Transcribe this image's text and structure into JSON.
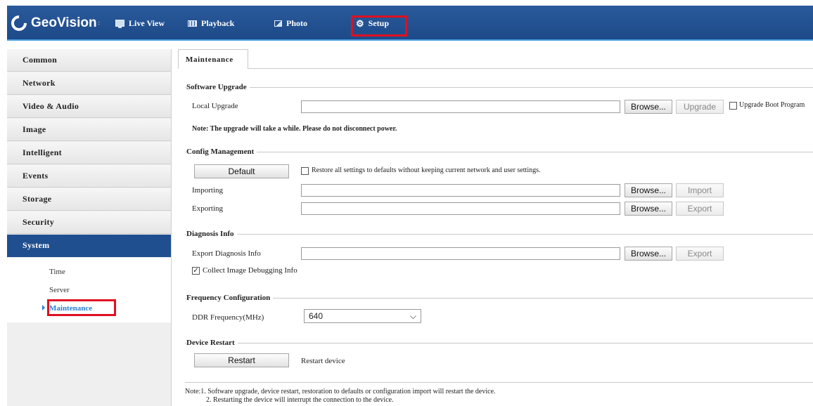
{
  "header": {
    "logo": "GeoVision",
    "logo_tm": ":",
    "nav": [
      {
        "label": "Live View",
        "icon": "monitor-icon"
      },
      {
        "label": "Playback",
        "icon": "film-icon"
      },
      {
        "label": "Photo",
        "icon": "photo-icon"
      },
      {
        "label": "Setup",
        "icon": "gear-icon"
      }
    ]
  },
  "sidebar": {
    "items": [
      "Common",
      "Network",
      "Video & Audio",
      "Image",
      "Intelligent",
      "Events",
      "Storage",
      "Security",
      "System"
    ],
    "sub_items": [
      "Time",
      "Server",
      "Maintenance"
    ]
  },
  "tab": "Maintenance",
  "software_upgrade": {
    "title": "Software Upgrade",
    "local_upgrade_label": "Local Upgrade",
    "browse": "Browse...",
    "upgrade": "Upgrade",
    "boot_label": "Upgrade Boot Program",
    "note": "Note: The upgrade will take a while. Please do not disconnect power."
  },
  "config": {
    "title": "Config Management",
    "default_btn": "Default",
    "restore_label": "Restore all settings to defaults without keeping current network and user settings.",
    "importing_label": "Importing",
    "exporting_label": "Exporting",
    "browse": "Browse...",
    "import_btn": "Import",
    "export_btn": "Export"
  },
  "diagnosis": {
    "title": "Diagnosis Info",
    "export_label": "Export Diagnosis Info",
    "browse": "Browse...",
    "export_btn": "Export",
    "collect_label": "Collect Image Debugging Info",
    "check_mark": "✓"
  },
  "frequency": {
    "title": "Frequency Configuration",
    "ddr_label": "DDR Frequency(MHz)",
    "ddr_value": "640",
    "arrow": "⌵"
  },
  "restart": {
    "title": "Device Restart",
    "restart_btn": "Restart",
    "restart_label": "Restart device"
  },
  "notes": {
    "line1": "Note:1. Software upgrade, device restart, restoration to defaults or configuration import will restart the device.",
    "line2": "2. Restarting the device will interrupt the connection to the device."
  }
}
